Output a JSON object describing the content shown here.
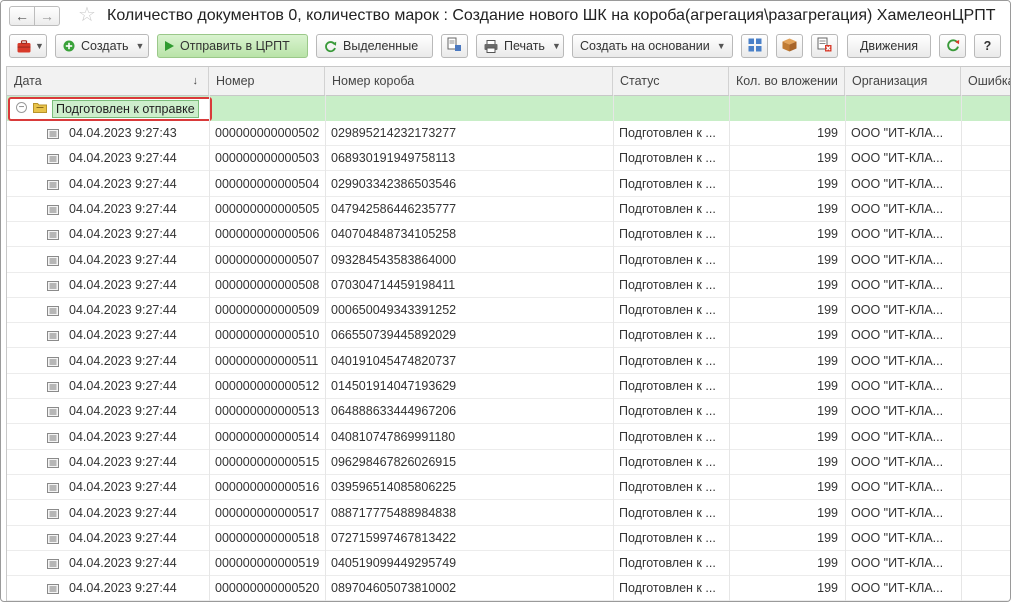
{
  "window": {
    "title": "Количество документов 0, количество марок : Создание нового ШК на короба(агрегация\\разагрегация) ХамелеонЦРПТ"
  },
  "toolbar": {
    "create_label": "Создать",
    "send_label": "Отправить в ЦРПТ",
    "selected_label": "Выделенные",
    "print_label": "Печать",
    "create_based_label": "Создать на основании",
    "movements_label": "Движения",
    "help_label": "?"
  },
  "columns": [
    "Дата",
    "Номер",
    "Номер короба",
    "Статус",
    "Кол. во вложении",
    "Организация",
    "Ошибка"
  ],
  "group": {
    "label": "Подготовлен к отправке"
  },
  "rows": [
    {
      "date": "04.04.2023 9:27:43",
      "number": "000000000000502",
      "box": "029895214232173277",
      "status": "Подготовлен к ...",
      "qty": "199",
      "org": "ООО \"ИТ-КЛА..."
    },
    {
      "date": "04.04.2023 9:27:44",
      "number": "000000000000503",
      "box": "068930191949758113",
      "status": "Подготовлен к ...",
      "qty": "199",
      "org": "ООО \"ИТ-КЛА..."
    },
    {
      "date": "04.04.2023 9:27:44",
      "number": "000000000000504",
      "box": "029903342386503546",
      "status": "Подготовлен к ...",
      "qty": "199",
      "org": "ООО \"ИТ-КЛА..."
    },
    {
      "date": "04.04.2023 9:27:44",
      "number": "000000000000505",
      "box": "047942586446235777",
      "status": "Подготовлен к ...",
      "qty": "199",
      "org": "ООО \"ИТ-КЛА..."
    },
    {
      "date": "04.04.2023 9:27:44",
      "number": "000000000000506",
      "box": "040704848734105258",
      "status": "Подготовлен к ...",
      "qty": "199",
      "org": "ООО \"ИТ-КЛА..."
    },
    {
      "date": "04.04.2023 9:27:44",
      "number": "000000000000507",
      "box": "093284543583864000",
      "status": "Подготовлен к ...",
      "qty": "199",
      "org": "ООО \"ИТ-КЛА..."
    },
    {
      "date": "04.04.2023 9:27:44",
      "number": "000000000000508",
      "box": "070304714459198411",
      "status": "Подготовлен к ...",
      "qty": "199",
      "org": "ООО \"ИТ-КЛА..."
    },
    {
      "date": "04.04.2023 9:27:44",
      "number": "000000000000509",
      "box": "000650049343391252",
      "status": "Подготовлен к ...",
      "qty": "199",
      "org": "ООО \"ИТ-КЛА..."
    },
    {
      "date": "04.04.2023 9:27:44",
      "number": "000000000000510",
      "box": "066550739445892029",
      "status": "Подготовлен к ...",
      "qty": "199",
      "org": "ООО \"ИТ-КЛА..."
    },
    {
      "date": "04.04.2023 9:27:44",
      "number": "000000000000511",
      "box": "040191045474820737",
      "status": "Подготовлен к ...",
      "qty": "199",
      "org": "ООО \"ИТ-КЛА..."
    },
    {
      "date": "04.04.2023 9:27:44",
      "number": "000000000000512",
      "box": "014501914047193629",
      "status": "Подготовлен к ...",
      "qty": "199",
      "org": "ООО \"ИТ-КЛА..."
    },
    {
      "date": "04.04.2023 9:27:44",
      "number": "000000000000513",
      "box": "064888633444967206",
      "status": "Подготовлен к ...",
      "qty": "199",
      "org": "ООО \"ИТ-КЛА..."
    },
    {
      "date": "04.04.2023 9:27:44",
      "number": "000000000000514",
      "box": "040810747869991180",
      "status": "Подготовлен к ...",
      "qty": "199",
      "org": "ООО \"ИТ-КЛА..."
    },
    {
      "date": "04.04.2023 9:27:44",
      "number": "000000000000515",
      "box": "096298467826026915",
      "status": "Подготовлен к ...",
      "qty": "199",
      "org": "ООО \"ИТ-КЛА..."
    },
    {
      "date": "04.04.2023 9:27:44",
      "number": "000000000000516",
      "box": "039596514085806225",
      "status": "Подготовлен к ...",
      "qty": "199",
      "org": "ООО \"ИТ-КЛА..."
    },
    {
      "date": "04.04.2023 9:27:44",
      "number": "000000000000517",
      "box": "088717775488984838",
      "status": "Подготовлен к ...",
      "qty": "199",
      "org": "ООО \"ИТ-КЛА..."
    },
    {
      "date": "04.04.2023 9:27:44",
      "number": "000000000000518",
      "box": "072715997467813422",
      "status": "Подготовлен к ...",
      "qty": "199",
      "org": "ООО \"ИТ-КЛА..."
    },
    {
      "date": "04.04.2023 9:27:44",
      "number": "000000000000519",
      "box": "040519099449295749",
      "status": "Подготовлен к ...",
      "qty": "199",
      "org": "ООО \"ИТ-КЛА..."
    },
    {
      "date": "04.04.2023 9:27:44",
      "number": "000000000000520",
      "box": "089704605073810002",
      "status": "Подготовлен к ...",
      "qty": "199",
      "org": "ООО \"ИТ-КЛА..."
    }
  ],
  "icons": {
    "back": "arrow-left-icon",
    "forward": "arrow-right-icon",
    "favorite": "star-icon",
    "doc": "document-icon",
    "group": "folder-icon"
  },
  "colors": {
    "group_row": "#c8eec7",
    "highlight": "#d93a3a",
    "send_button": "#c8ecb9"
  }
}
